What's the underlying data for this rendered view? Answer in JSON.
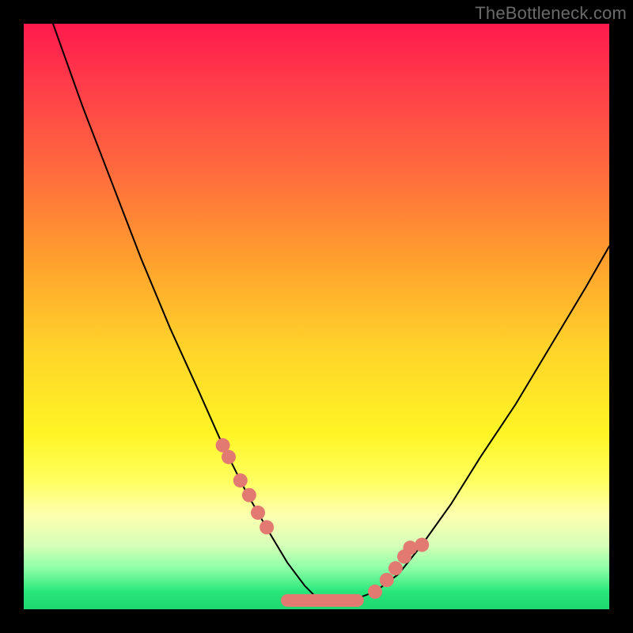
{
  "watermark": "TheBottleneck.com",
  "colors": {
    "marker": "#e37a72",
    "curve": "#000000"
  },
  "chart_data": {
    "type": "line",
    "title": "",
    "xlabel": "",
    "ylabel": "",
    "xlim": [
      0,
      100
    ],
    "ylim": [
      0,
      100
    ],
    "grid": false,
    "series": [
      {
        "name": "bottleneck-curve",
        "x": [
          5,
          10,
          15,
          20,
          25,
          30,
          34,
          38,
          42,
          45,
          48,
          50,
          53,
          56,
          60,
          64,
          68,
          73,
          78,
          84,
          90,
          96,
          100
        ],
        "values": [
          100,
          86,
          73,
          60,
          48,
          37,
          28,
          20,
          13,
          8,
          4,
          2,
          1.5,
          1.5,
          3,
          6,
          11,
          18,
          26,
          35,
          45,
          55,
          62
        ]
      }
    ],
    "markers": {
      "name": "highlight-dots",
      "x": [
        34,
        35,
        37,
        38.5,
        40,
        41.5,
        60,
        62,
        63.5,
        65,
        66,
        68
      ],
      "values": [
        28,
        26,
        22,
        19.5,
        16.5,
        14,
        3,
        5,
        7,
        9,
        10.5,
        11
      ]
    },
    "flat_segment": {
      "name": "valley-flat",
      "x": [
        45,
        57
      ],
      "value": 1.5
    }
  }
}
